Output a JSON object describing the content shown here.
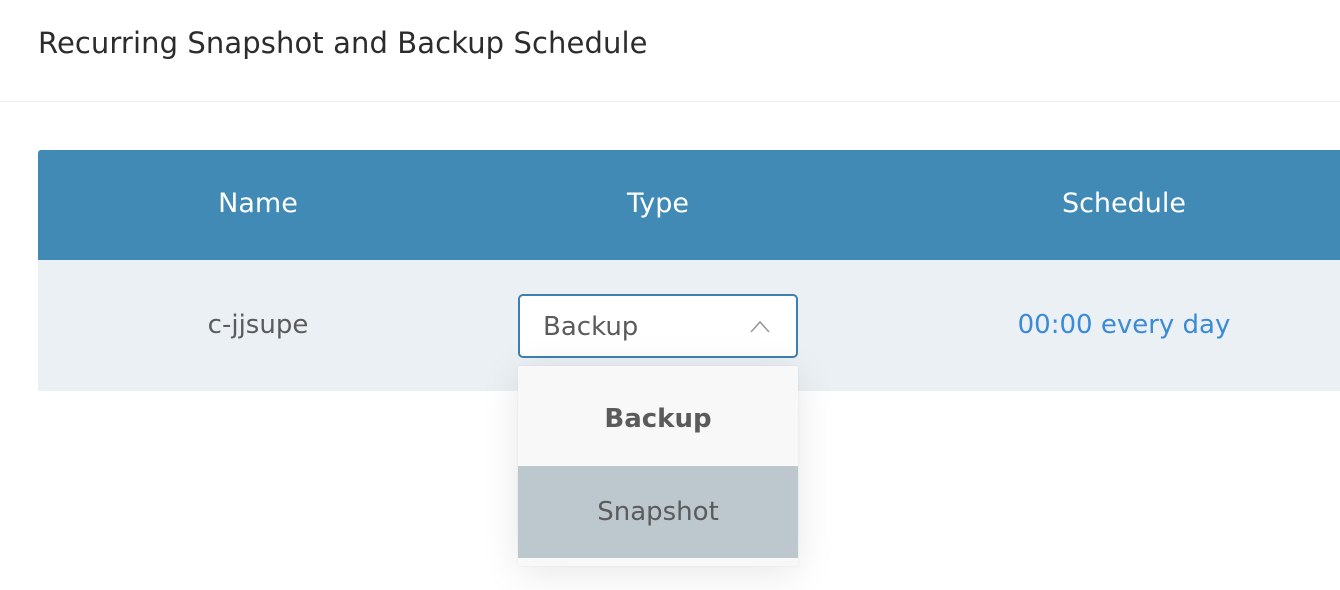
{
  "header": {
    "title": "Recurring Snapshot and Backup Schedule"
  },
  "table": {
    "columns": [
      "Name",
      "Type",
      "Schedule"
    ],
    "rows": [
      {
        "name": "c-jjsupe",
        "type": "Backup",
        "schedule": "00:00 every day"
      }
    ]
  },
  "type_dropdown": {
    "selected": "Backup",
    "expanded": true,
    "options": [
      "Backup",
      "Snapshot"
    ],
    "highlighted": "Snapshot",
    "chevron_icon": "chevron-up-icon"
  },
  "colors": {
    "header_bg": "#418ab6",
    "row_bg": "#ebf0f5",
    "link": "#3a8ad6",
    "select_border": "#3e7fae",
    "highlight_bg": "#bcc8cd"
  }
}
